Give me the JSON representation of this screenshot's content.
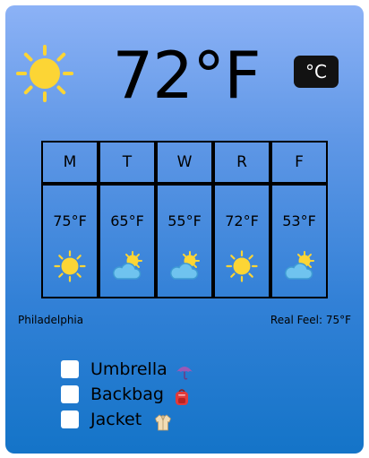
{
  "current": {
    "temperature": "72°F",
    "icon": "sun-icon",
    "unit_toggle_label": "°C"
  },
  "forecast": [
    {
      "day": "M",
      "temp": "75°F",
      "icon": "sun-icon"
    },
    {
      "day": "T",
      "temp": "65°F",
      "icon": "partly-cloudy-icon"
    },
    {
      "day": "W",
      "temp": "55°F",
      "icon": "partly-cloudy-icon"
    },
    {
      "day": "R",
      "temp": "72°F",
      "icon": "sun-icon"
    },
    {
      "day": "F",
      "temp": "53°F",
      "icon": "partly-cloudy-icon"
    }
  ],
  "location": "Philadelphia",
  "real_feel": {
    "label": "Real Feel:",
    "value": "75°F"
  },
  "checklist": [
    {
      "label": "Umbrella",
      "icon": "umbrella-icon"
    },
    {
      "label": "Backbag",
      "icon": "backpack-icon"
    },
    {
      "label": "Jacket",
      "icon": "jacket-icon"
    }
  ],
  "colors": {
    "sun": "#fcd535",
    "cloud": "#6fc3ef",
    "background_top": "#8cb2f6",
    "background_bottom": "#1474c8",
    "button": "#121212"
  }
}
